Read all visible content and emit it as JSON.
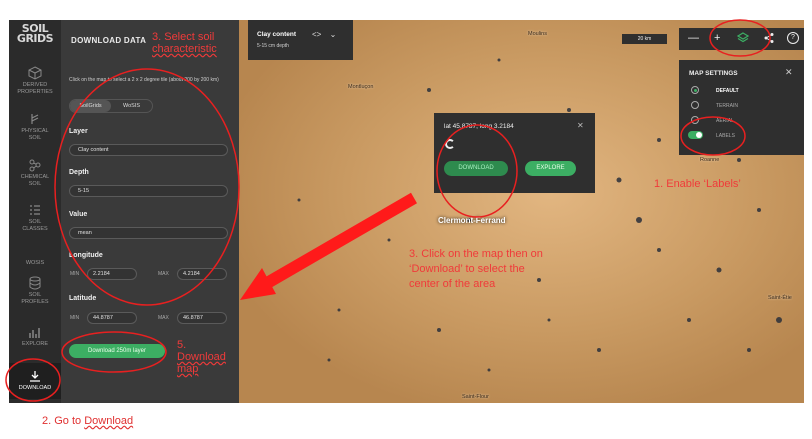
{
  "rail": {
    "logo_line1": "SOIL",
    "logo_line2": "GRIDS",
    "items": [
      {
        "label1": "DERIVED",
        "label2": "PROPERTIES"
      },
      {
        "label1": "PHYSICAL",
        "label2": "SOIL"
      },
      {
        "label1": "CHEMICAL",
        "label2": "SOIL"
      },
      {
        "label1": "SOIL",
        "label2": "CLASSES"
      },
      {
        "label1": "WOSIS",
        "label2": ""
      },
      {
        "label1": "SOIL",
        "label2": "PROFILES"
      },
      {
        "label1": "EXPLORE",
        "label2": ""
      },
      {
        "label1": "DOWNLOAD",
        "label2": ""
      }
    ]
  },
  "panel": {
    "title": "DOWNLOAD DATA",
    "help": "Click on the map to select a 2 x 2 degree tile (about 200 by 200 km)",
    "tabs": [
      "SoilGrids",
      "WoSIS"
    ],
    "layer_label": "Layer",
    "layer_value": "Clay content",
    "depth_label": "Depth",
    "depth_value": "5-15",
    "value_label": "Value",
    "value_value": "mean",
    "longitude_label": "Longitude",
    "latitude_label": "Latitude",
    "min_label": "MIN",
    "max_label": "MAX",
    "lon_min": "2.2184",
    "lon_max": "4.2184",
    "lat_min": "44.8787",
    "lat_max": "46.8787",
    "download_button": "Download 250m layer"
  },
  "layer_box": {
    "title": "Clay content",
    "subtitle": "5-15 cm depth"
  },
  "map": {
    "scale": "20 km",
    "places": [
      "Moulins",
      "Montluçon",
      "Roanne",
      "Clermont-Ferrand",
      "Saint-Étie",
      "Saint-Flour"
    ]
  },
  "toolbar": {
    "zoom_out": "—",
    "zoom_in": "+",
    "help": "?"
  },
  "settings": {
    "title": "MAP SETTINGS",
    "options": [
      "DEFAULT",
      "TERRAIN",
      "AERIAL",
      "LABELS"
    ]
  },
  "popup": {
    "coords": "lat 45.8787, long 3.2184",
    "download": "DOWNLOAD",
    "explore": "EXPLORE"
  },
  "annotations": {
    "step1": "1. Enable ‘Labels’",
    "step2_prefix": "2. Go to ",
    "step2_link": "Download",
    "step3a_l1": "3. Select soil",
    "step3a_l2": "characteristic",
    "step3b": "3. Click on the map then on ‘Download’ to select the center of the area",
    "step5_l1": "5.",
    "step5_l2": "Download",
    "step5_l3": "map"
  },
  "colors": {
    "accent": "#3cae63",
    "annotation": "#f03a3a",
    "panel": "#3a3a3a",
    "map": "#c89a63"
  }
}
